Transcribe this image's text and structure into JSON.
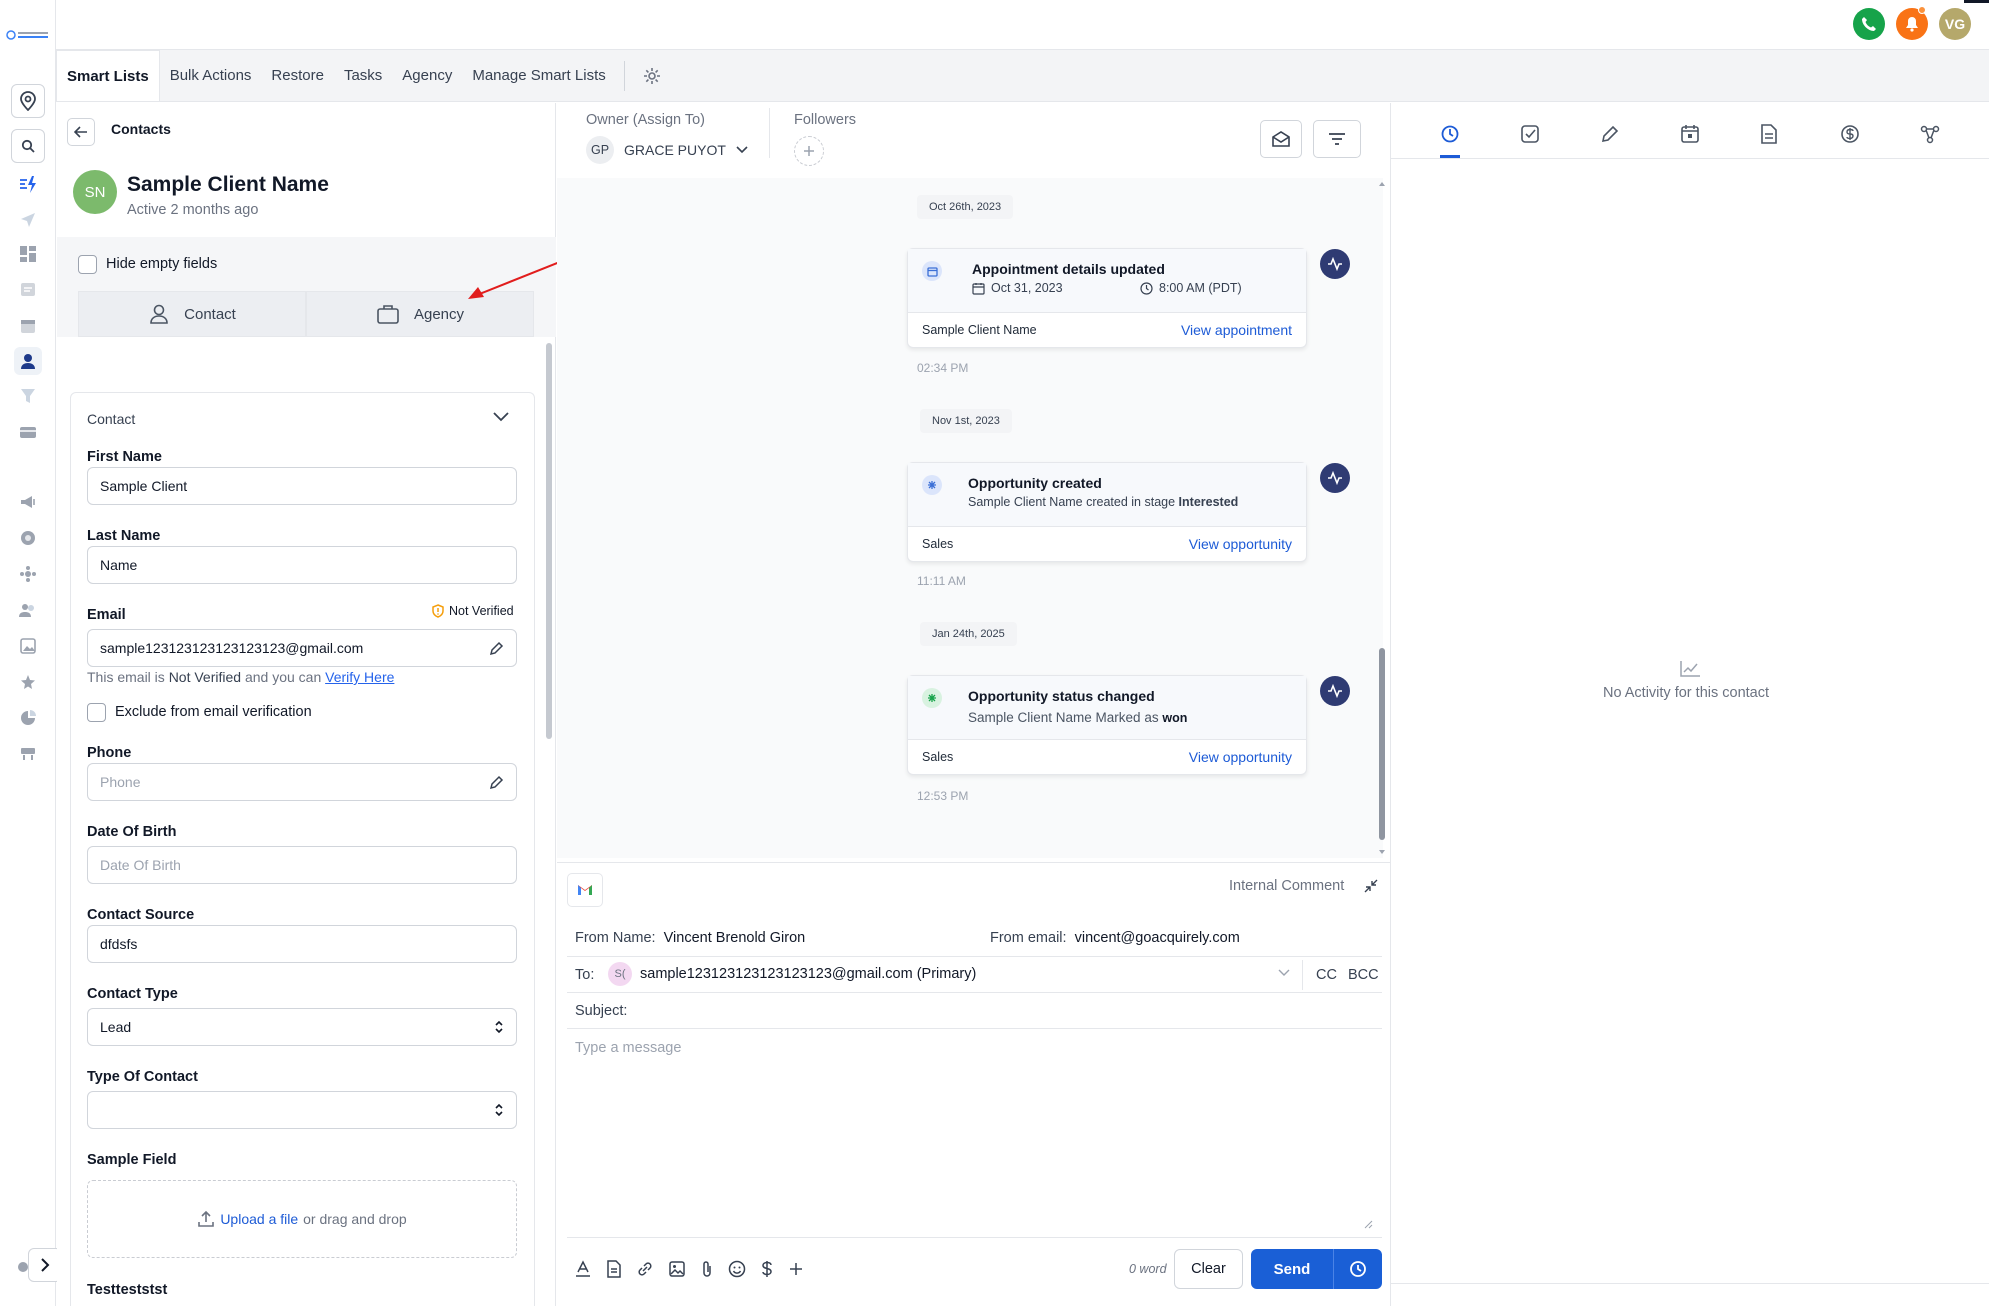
{
  "topbar": {
    "avatar_initials": "VG"
  },
  "nav_tabs": {
    "smart_lists": "Smart Lists",
    "bulk_actions": "Bulk Actions",
    "restore": "Restore",
    "tasks": "Tasks",
    "agency": "Agency",
    "manage_smart_lists": "Manage Smart Lists"
  },
  "contact_panel": {
    "breadcrumb": "Contacts",
    "avatar_initials": "SN",
    "name": "Sample Client Name",
    "status": "Active 2 months ago",
    "hide_empty_label": "Hide empty fields",
    "tab_contact": "Contact",
    "tab_agency": "Agency",
    "section_title": "Contact",
    "first_name_label": "First Name",
    "first_name_value": "Sample Client",
    "last_name_label": "Last Name",
    "last_name_value": "Name",
    "email_label": "Email",
    "not_verified": "Not Verified",
    "email_value": "sample123123123123123123@gmail.com",
    "email_note_prefix": "This email is",
    "email_note_bold": "Not Verified",
    "email_note_mid": "and you can",
    "verify_link": "Verify Here",
    "exclude_label": "Exclude from email verification",
    "phone_label": "Phone",
    "phone_placeholder": "Phone",
    "dob_label": "Date Of Birth",
    "dob_placeholder": "Date Of Birth",
    "source_label": "Contact Source",
    "source_value": "dfdsfs",
    "type_label": "Contact Type",
    "type_value": "Lead",
    "type_of_contact_label": "Type Of Contact",
    "type_of_contact_value": "",
    "sample_field_label": "Sample Field",
    "upload_link": "Upload a file",
    "upload_rest": "or drag and drop",
    "testtest_label": "Testteststst"
  },
  "owner": {
    "label": "Owner (Assign To)",
    "initials": "GP",
    "name": "GRACE PUYOT",
    "followers_label": "Followers"
  },
  "feed": [
    {
      "date": "Oct 26th, 2023",
      "title": "Appointment details updated",
      "date_value": "Oct 31, 2023",
      "time_value": "8:00 AM (PDT)",
      "footer_left": "Sample Client Name",
      "footer_link": "View appointment",
      "time": "02:34 PM"
    },
    {
      "date": "Nov 1st, 2023",
      "title": "Opportunity created",
      "desc_prefix": "Sample Client Name created in stage",
      "desc_bold": "Interested",
      "footer_left": "Sales",
      "footer_link": "View opportunity",
      "time": "11:11 AM"
    },
    {
      "date": "Jan 24th, 2025",
      "title": "Opportunity status changed",
      "desc_prefix": "Sample Client Name Marked as",
      "desc_bold": "won",
      "footer_left": "Sales",
      "footer_link": "View opportunity",
      "time": "12:53 PM"
    }
  ],
  "composer": {
    "internal_comment": "Internal Comment",
    "from_name_label": "From Name:",
    "from_name_value": "Vincent Brenold Giron",
    "from_email_label": "From email:",
    "from_email_value": "vincent@goacquirely.com",
    "to_label": "To:",
    "to_chip": "S(",
    "to_value": "sample123123123123123123@gmail.com (Primary)",
    "cc": "CC",
    "bcc": "BCC",
    "subject_label": "Subject:",
    "message_placeholder": "Type a message",
    "word_count": "0 word",
    "clear": "Clear",
    "send": "Send"
  },
  "right_panel": {
    "empty_text": "No Activity for this contact"
  },
  "colors": {
    "accent": "#1a5fd6",
    "send_button": "#1a5fd6",
    "avatar_green": "#7cba6c",
    "phone_green": "#16a34a",
    "bell_orange": "#f97316",
    "user_avatar": "#b5a86b",
    "pulse_navy": "#2f3b73",
    "arrow_red": "#e11d1d"
  }
}
